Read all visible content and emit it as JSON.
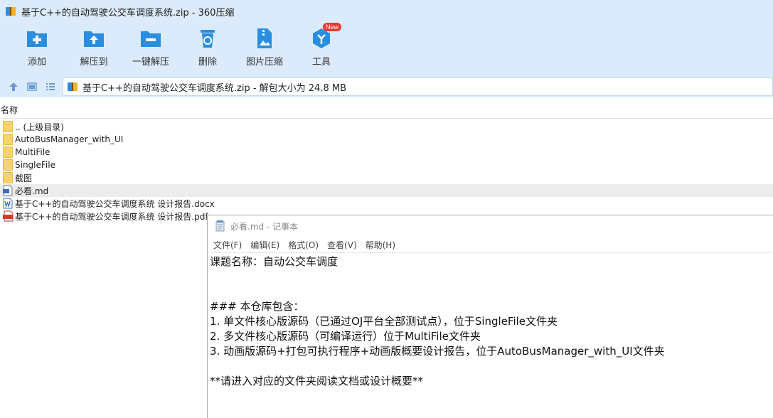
{
  "window": {
    "title": "基于C++的自动驾驶公交车调度系统.zip - 360压缩"
  },
  "toolbar": {
    "add_label": "添加",
    "extract_to_label": "解压到",
    "one_click_extract_label": "一键解压",
    "delete_label": "删除",
    "image_compress_label": "图片压缩",
    "tools_label": "工具",
    "tools_badge": "New"
  },
  "address": {
    "path": "基于C++的自动驾驶公交车调度系统.zip - 解包大小为 24.8 MB"
  },
  "list": {
    "column_name": "名称",
    "items": [
      {
        "name": ".. (上级目录)",
        "type": "folder"
      },
      {
        "name": "AutoBusManager_with_UI",
        "type": "folder"
      },
      {
        "name": "MultiFile",
        "type": "folder"
      },
      {
        "name": "SingleFile",
        "type": "folder"
      },
      {
        "name": "截图",
        "type": "folder"
      },
      {
        "name": "必看.md",
        "type": "md"
      },
      {
        "name": "基于C++的自动驾驶公交车调度系统 设计报告.docx",
        "type": "docx"
      },
      {
        "name": "基于C++的自动驾驶公交车调度系统 设计报告.pdf",
        "type": "pdf"
      }
    ]
  },
  "notepad": {
    "title": "必看.md - 记事本",
    "menu": [
      "文件(F)",
      "编辑(E)",
      "格式(O)",
      "查看(V)",
      "帮助(H)"
    ],
    "lines": [
      "课题名称：自动公交车调度",
      "",
      "",
      "### 本仓库包含：",
      "1. 单文件核心版源码（已通过OJ平台全部测试点），位于SingleFile文件夹",
      "2. 多文件核心版源码（可编译运行）位于MultiFile文件夹",
      "3. 动画版源码+打包可执行程序+动画版概要设计报告，位于AutoBusManager_with_UI文件夹",
      "",
      "**请进入对应的文件夹阅读文档或设计概要**"
    ]
  },
  "colors": {
    "header_bg": "#dcebfb",
    "icon_blue": "#2a8ee0",
    "badge_red": "#e6382f"
  }
}
